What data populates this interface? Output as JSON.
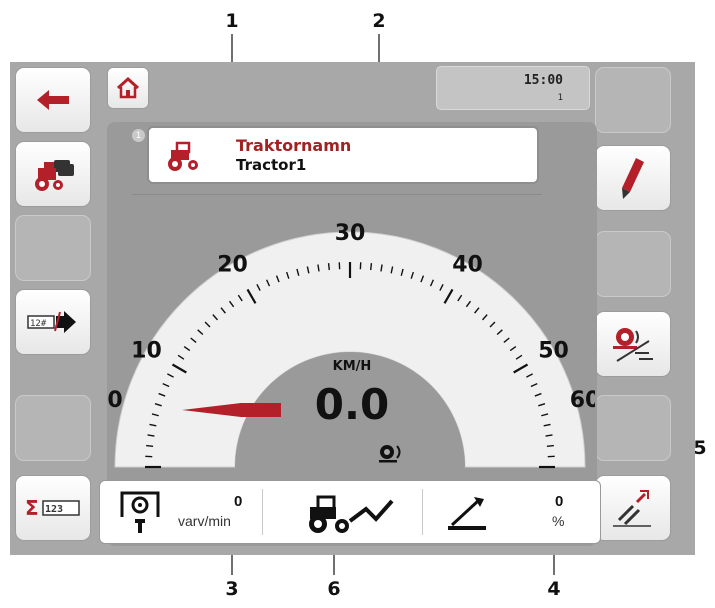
{
  "callouts": {
    "c1": "1",
    "c2": "2",
    "c3": "3",
    "c4": "4",
    "c5": "5",
    "c6": "6"
  },
  "header": {
    "time": "15:00",
    "sub": "1"
  },
  "tractor": {
    "title": "Traktornamn",
    "value": "Tractor1",
    "badge": "1"
  },
  "speedometer": {
    "unit": "KM/H",
    "value": "0.0",
    "ticks": [
      "0",
      "10",
      "20",
      "30",
      "40",
      "50",
      "60"
    ],
    "min": 0,
    "max": 60,
    "current": 0
  },
  "bottom": {
    "rpm_value": "0",
    "rpm_unit": "varv/min",
    "pct_value": "0",
    "pct_unit": "%"
  },
  "left_buttons": [
    "back-arrow-icon",
    "tractor-list-icon",
    "empty",
    "import-icon",
    "empty",
    "sum-counter-icon"
  ],
  "right_buttons": [
    "empty",
    "edit-pencil-icon",
    "empty",
    "wheel-sensor-icon",
    "empty",
    "calibrate-icon"
  ],
  "colors": {
    "accent": "#a62020",
    "screen": "#a8a8a8",
    "panel": "#9a9a9a"
  }
}
